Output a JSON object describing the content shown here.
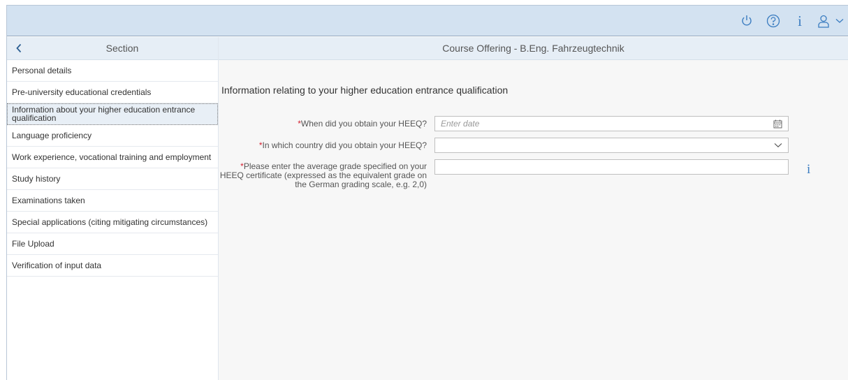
{
  "shell": {
    "icons": [
      "power-icon",
      "help-icon",
      "info-icon",
      "user-icon",
      "chevron-down-icon"
    ],
    "info_glyph": "i",
    "accent": "#3a7cc0",
    "background": "#d3e2f1"
  },
  "sidebar": {
    "title": "Section",
    "items": [
      {
        "label": "Personal details"
      },
      {
        "label": "Pre-university educational credentials"
      },
      {
        "label": "Information about your higher education entrance qualification"
      },
      {
        "label": "Language proficiency"
      },
      {
        "label": "Work experience, vocational training and employment"
      },
      {
        "label": "Study history"
      },
      {
        "label": "Examinations taken"
      },
      {
        "label": "Special applications (citing mitigating circumstances)"
      },
      {
        "label": "File Upload"
      },
      {
        "label": "Verification of input data"
      }
    ],
    "selected_index": 2
  },
  "main": {
    "header": "Course Offering - B.Eng. Fahrzeugtechnik",
    "form_title": "Information relating to your higher education entrance qualification",
    "required_marker": "*",
    "required_color": "#d32030",
    "fields": {
      "date": {
        "label": "When did you obtain your HEEQ?",
        "placeholder": "Enter date",
        "value": ""
      },
      "country": {
        "label": "In which country did you obtain your HEEQ?",
        "value": ""
      },
      "grade": {
        "label": "Please enter the average grade specified on your HEEQ certificate (expressed as the equivalent grade on the German grading scale, e.g. 2,0)",
        "value": "",
        "info_glyph": "i"
      }
    }
  }
}
